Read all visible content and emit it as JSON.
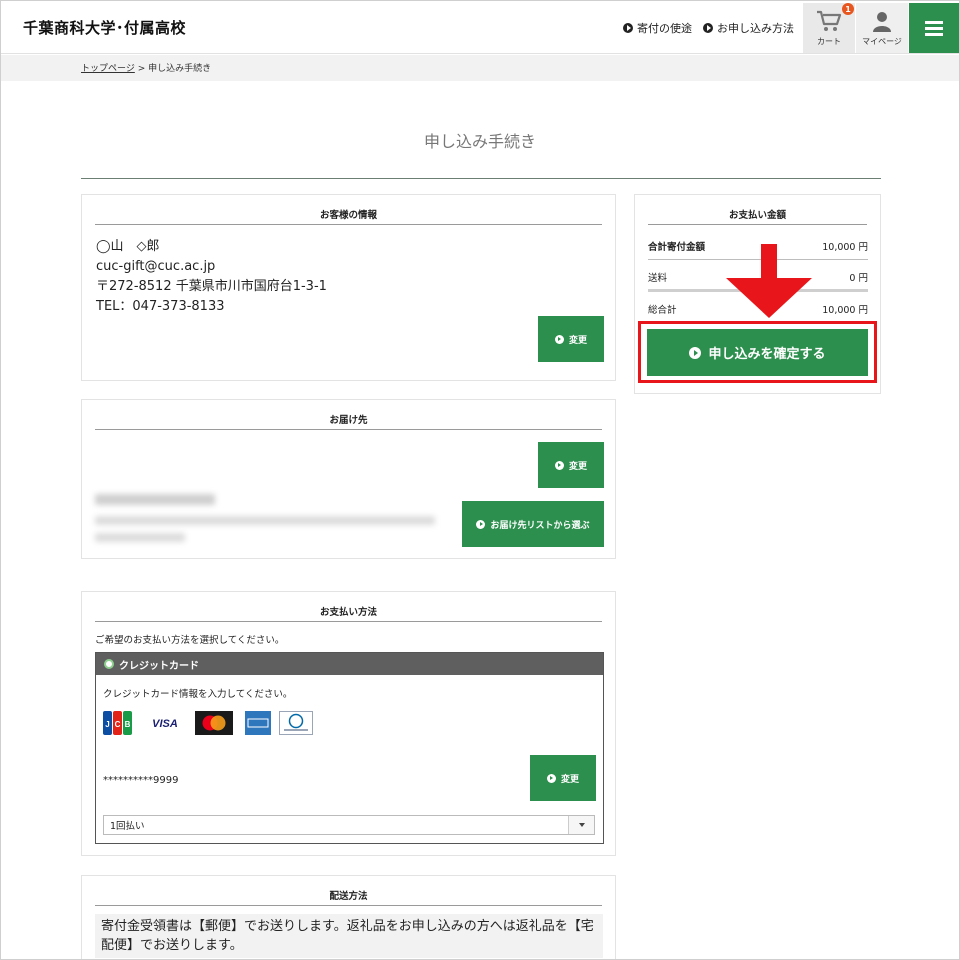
{
  "header": {
    "logo": "千葉商科大学･付属高校",
    "nav_usage": "寄付の使途",
    "nav_howto": "お申し込み方法",
    "cart_label": "カート",
    "cart_count": "1",
    "mypage_label": "マイページ"
  },
  "breadcrumb": {
    "home": "トップページ",
    "separator": " > ",
    "current": "申し込み手続き"
  },
  "page_title": "申し込み手続き",
  "customer": {
    "heading": "お客様の情報",
    "name": "◯山　◇郎",
    "email": "cuc-gift@cuc.ac.jp",
    "address": "〒272-8512 千葉県市川市国府台1-3-1",
    "tel": "TEL：047-373-8133",
    "change_label": "変更"
  },
  "delivery": {
    "heading": "お届け先",
    "change_label": "変更",
    "select_list_label": "お届け先リストから選ぶ"
  },
  "payment": {
    "heading": "お支払い方法",
    "note": "ご希望のお支払い方法を選択してください。",
    "method": "クレジットカード",
    "card_note": "クレジットカード情報を入力してください。",
    "brands": [
      "JCB",
      "VISA",
      "Mastercard",
      "AMEX",
      "Diners Club"
    ],
    "masked_number": "**********9999",
    "change_label": "変更",
    "installment": "1回払い"
  },
  "shipping": {
    "heading": "配送方法",
    "text": "寄付金受領書は【郵便】でお送りします。返礼品をお申し込みの方へは返礼品を【宅配便】でお送りします。"
  },
  "summary": {
    "heading": "お支払い金額",
    "donation_label": "合計寄付金額",
    "donation_value": "10,000 円",
    "shipping_label": "送料",
    "shipping_value": "0 円",
    "total_label": "総合計",
    "total_value": "10,000 円",
    "confirm_label": "申し込みを確定する"
  },
  "colors": {
    "brand_green": "#2d8f4e",
    "highlight_red": "#e8161a",
    "cc_header": "#5f5f5f"
  }
}
